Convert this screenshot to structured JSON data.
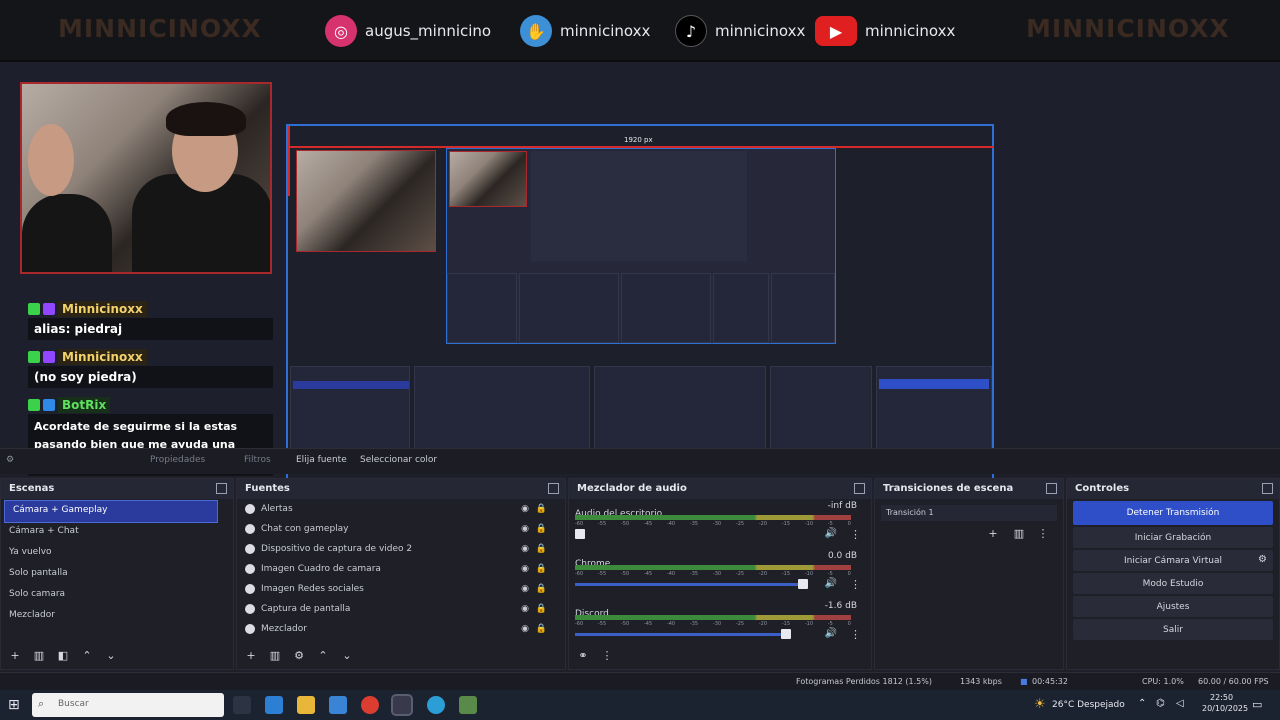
{
  "banner": {
    "brand_left": "MINNICINOXX",
    "brand_right": "MINNICINOXX",
    "socials": [
      {
        "icon": "instagram-icon",
        "handle": "augus_minnicino",
        "color": "#d6326e"
      },
      {
        "icon": "handshake-icon",
        "handle": "minnicinoxx",
        "color": "#3d8fd6"
      },
      {
        "icon": "tiktok-icon",
        "handle": "minnicinoxx",
        "color": "#000000"
      },
      {
        "icon": "youtube-icon",
        "handle": "minnicinoxx",
        "color": "#e02020"
      }
    ]
  },
  "chat": [
    {
      "user": "Minnicinoxx",
      "message": "alias: piedraj"
    },
    {
      "user": "Minnicinoxx",
      "message": "(no soy piedra)"
    },
    {
      "user": "BotRix",
      "message": "Acordate de seguirme si la estas pasando bien que me ayuda una locura anasheee"
    }
  ],
  "toolbar": {
    "properties": "Propiedades",
    "filters": "Filtros",
    "pick_source": "Elija fuente",
    "select_color": "Seleccionar color"
  },
  "scenes": {
    "title": "Escenas",
    "items": [
      "Cámara + Gameplay",
      "Cámara + Chat",
      "Ya vuelvo",
      "Solo pantalla",
      "Solo camara",
      "Mezclador"
    ],
    "selected_index": 0
  },
  "sources": {
    "title": "Fuentes",
    "items": [
      "Alertas",
      "Chat con gameplay",
      "Dispositivo de captura de video 2",
      "Imagen Cuadro de camara",
      "Imagen Redes sociales",
      "Captura de pantalla",
      "Mezclador"
    ]
  },
  "mixer": {
    "title": "Mezclador de audio",
    "channels": [
      {
        "name": "Audio del escritorio",
        "db": "-inf dB",
        "level": 0.02
      },
      {
        "name": "Chrome",
        "db": "0.0 dB",
        "level": 0.95
      },
      {
        "name": "Discord",
        "db": "-1.6 dB",
        "level": 0.88
      }
    ],
    "ticks": [
      "-60",
      "-55",
      "-50",
      "-45",
      "-40",
      "-35",
      "-30",
      "-25",
      "-20",
      "-15",
      "-10",
      "-5",
      "0"
    ]
  },
  "transitions": {
    "title": "Transiciones de escena",
    "selected": "Transición 1"
  },
  "controls": {
    "title": "Controles",
    "buttons": [
      "Detener Transmisión",
      "Iniciar Grabación",
      "Iniciar Cámara Virtual",
      "Modo Estudio",
      "Ajustes",
      "Salir"
    ]
  },
  "status": {
    "dropped_frames": "Fotogramas Perdidos 1812 (1.5%)",
    "bitrate": "1343 kbps",
    "time": "00:45:32",
    "cpu": "CPU: 1.0%",
    "fps": "60.00 / 60.00 FPS"
  },
  "taskbar": {
    "search_placeholder": "Buscar",
    "weather": "26°C  Despejado",
    "clock_time": "22:50",
    "clock_date": "20/10/2025"
  },
  "inner_preview": {
    "width_label": "1920 px"
  }
}
